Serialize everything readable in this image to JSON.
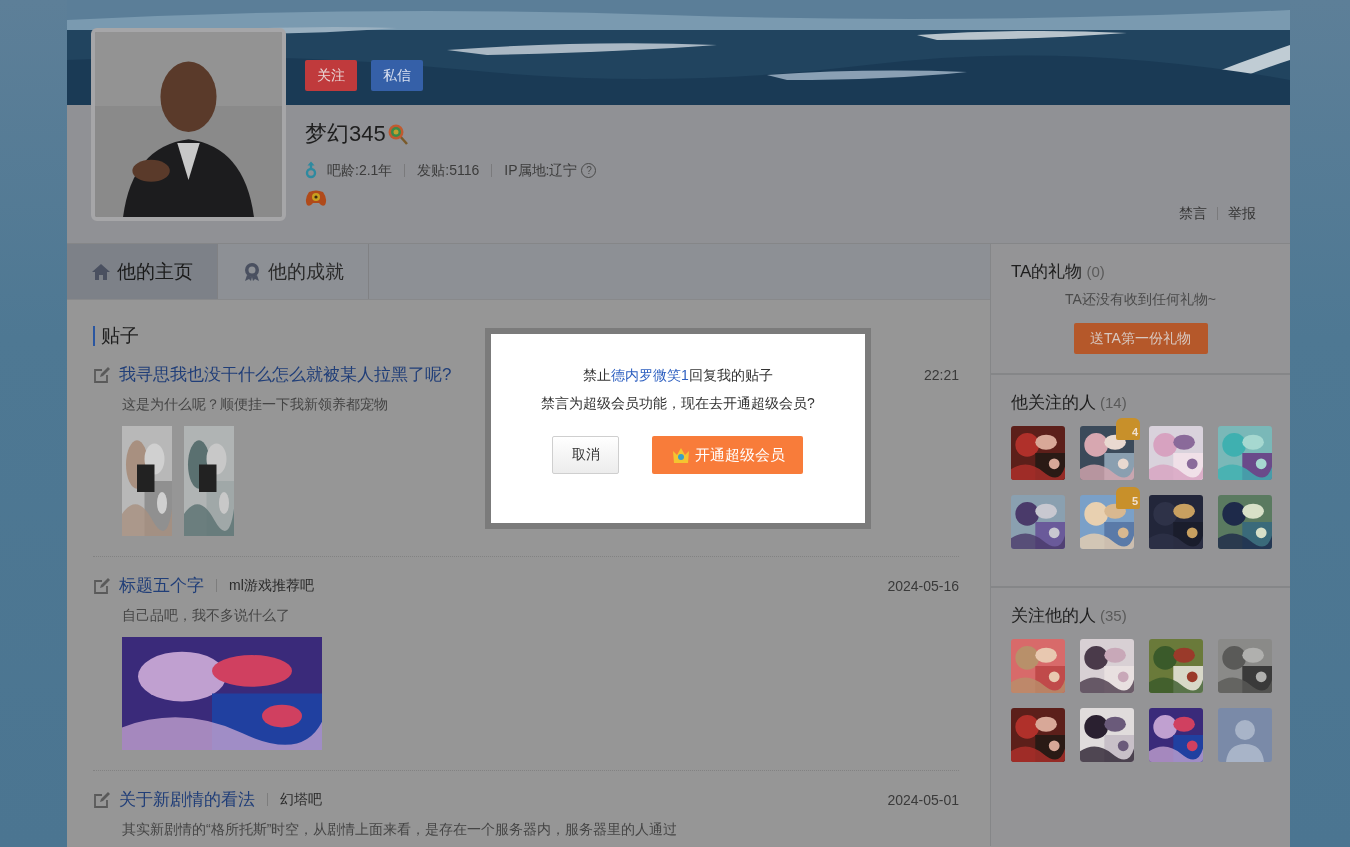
{
  "header": {
    "buttons": [
      {
        "label": "关注",
        "kind": "follow"
      },
      {
        "label": "私信",
        "kind": "message"
      }
    ],
    "username": "梦幻345",
    "stats": [
      "吧龄:2.1年",
      "发贴:5116",
      "IP属地:辽宁"
    ],
    "ip_help": "?",
    "actions": [
      "禁言",
      "举报"
    ]
  },
  "tabs": [
    {
      "label": "他的主页",
      "kind": "home",
      "selected": true
    },
    {
      "label": "他的成就",
      "kind": "achievement",
      "selected": false
    }
  ],
  "posts_section": {
    "title": "贴子"
  },
  "posts": [
    {
      "title": "我寻思我也没干什么怎么就被某人拉黑了呢?",
      "time": "22:21",
      "excerpt": "这是为什么呢？顺便挂一下我新领养都宠物",
      "images": [
        {
          "kind": "picture"
        },
        {
          "kind": "picture"
        }
      ]
    },
    {
      "title": "标题五个字",
      "forum": "ml游戏推荐吧",
      "time": "2024-05-16",
      "excerpt": "自己品吧，我不多说什么了",
      "images": [
        {
          "kind": "picture"
        }
      ]
    },
    {
      "title": "关于新剧情的看法",
      "forum": "幻塔吧",
      "time": "2024-05-01",
      "excerpt": "其实新剧情的“格所托斯”时空，从剧情上面来看，是存在一个服务器内，服务器里的人通过"
    }
  ],
  "sidebar": {
    "gifts": {
      "title": "TA的礼物",
      "count": "(0)",
      "empty": "TA还没有收到任何礼物~",
      "button": "送TA第一份礼物"
    },
    "following": {
      "title": "他关注的人",
      "count": "(14)",
      "users": [
        {
          "kind": "picture"
        },
        {
          "kind": "picture",
          "badge": "4"
        },
        {
          "kind": "picture"
        },
        {
          "kind": "picture"
        },
        {
          "kind": "picture"
        },
        {
          "kind": "picture",
          "badge": "5"
        },
        {
          "kind": "picture"
        },
        {
          "kind": "picture"
        }
      ]
    },
    "followers": {
      "title": "关注他的人",
      "count": "(35)",
      "users": [
        {
          "kind": "picture"
        },
        {
          "kind": "picture"
        },
        {
          "kind": "picture"
        },
        {
          "kind": "picture"
        },
        {
          "kind": "picture"
        },
        {
          "kind": "picture"
        },
        {
          "kind": "picture"
        },
        {
          "kind": "default"
        }
      ]
    }
  },
  "dialog": {
    "before": "禁止",
    "user": "德内罗微笑1",
    "after": "回复我的贴子",
    "question": "禁言为超级会员功能，现在去开通超级会员?",
    "buttons": [
      {
        "label": "取消",
        "kind": "cancel"
      },
      {
        "label": "开通超级会员",
        "kind": "primary"
      }
    ]
  }
}
